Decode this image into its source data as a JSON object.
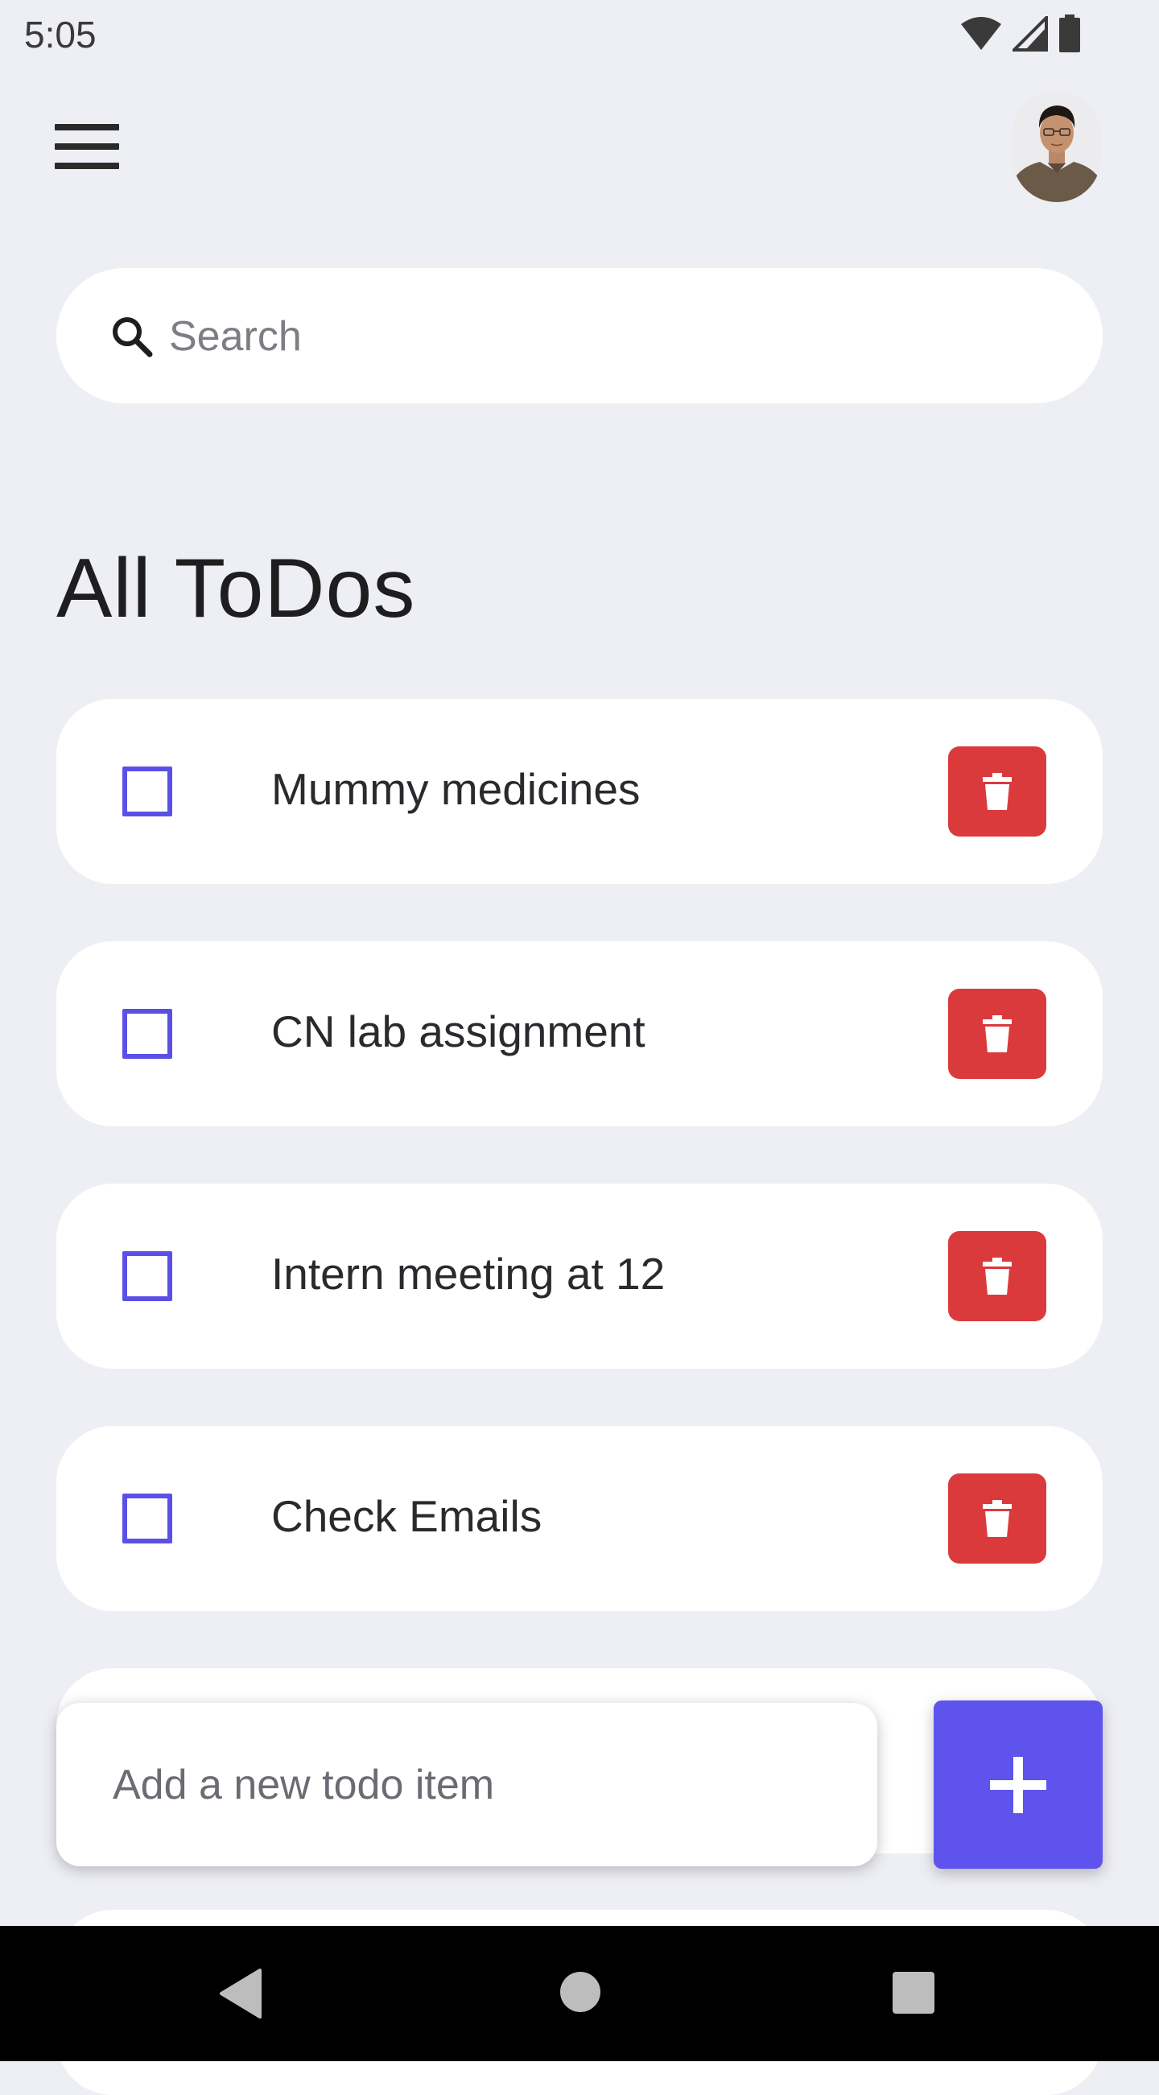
{
  "status_bar": {
    "time": "5:05",
    "icons": [
      "wifi-icon",
      "cellular-signal-icon",
      "battery-icon"
    ]
  },
  "header": {
    "menu_icon": "hamburger-menu-icon",
    "avatar": "user-avatar"
  },
  "search": {
    "placeholder": "Search",
    "value": "",
    "icon": "search-icon"
  },
  "page_title": "All ToDos",
  "todos": [
    {
      "label": "Mummy medicines",
      "checked": false
    },
    {
      "label": "CN lab assignment",
      "checked": false
    },
    {
      "label": "Intern meeting at 12",
      "checked": false
    },
    {
      "label": "Check Emails",
      "checked": false
    }
  ],
  "add_todo": {
    "placeholder": "Add a new todo item",
    "value": "",
    "button_icon": "plus-icon"
  },
  "nav_bar": {
    "buttons": [
      "back-icon",
      "home-icon",
      "recents-icon"
    ]
  },
  "colors": {
    "background": "#EEEFF5",
    "checkbox_accent": "#5B50E6",
    "delete_red": "#DB3A3D",
    "add_button": "#5F53EE"
  }
}
